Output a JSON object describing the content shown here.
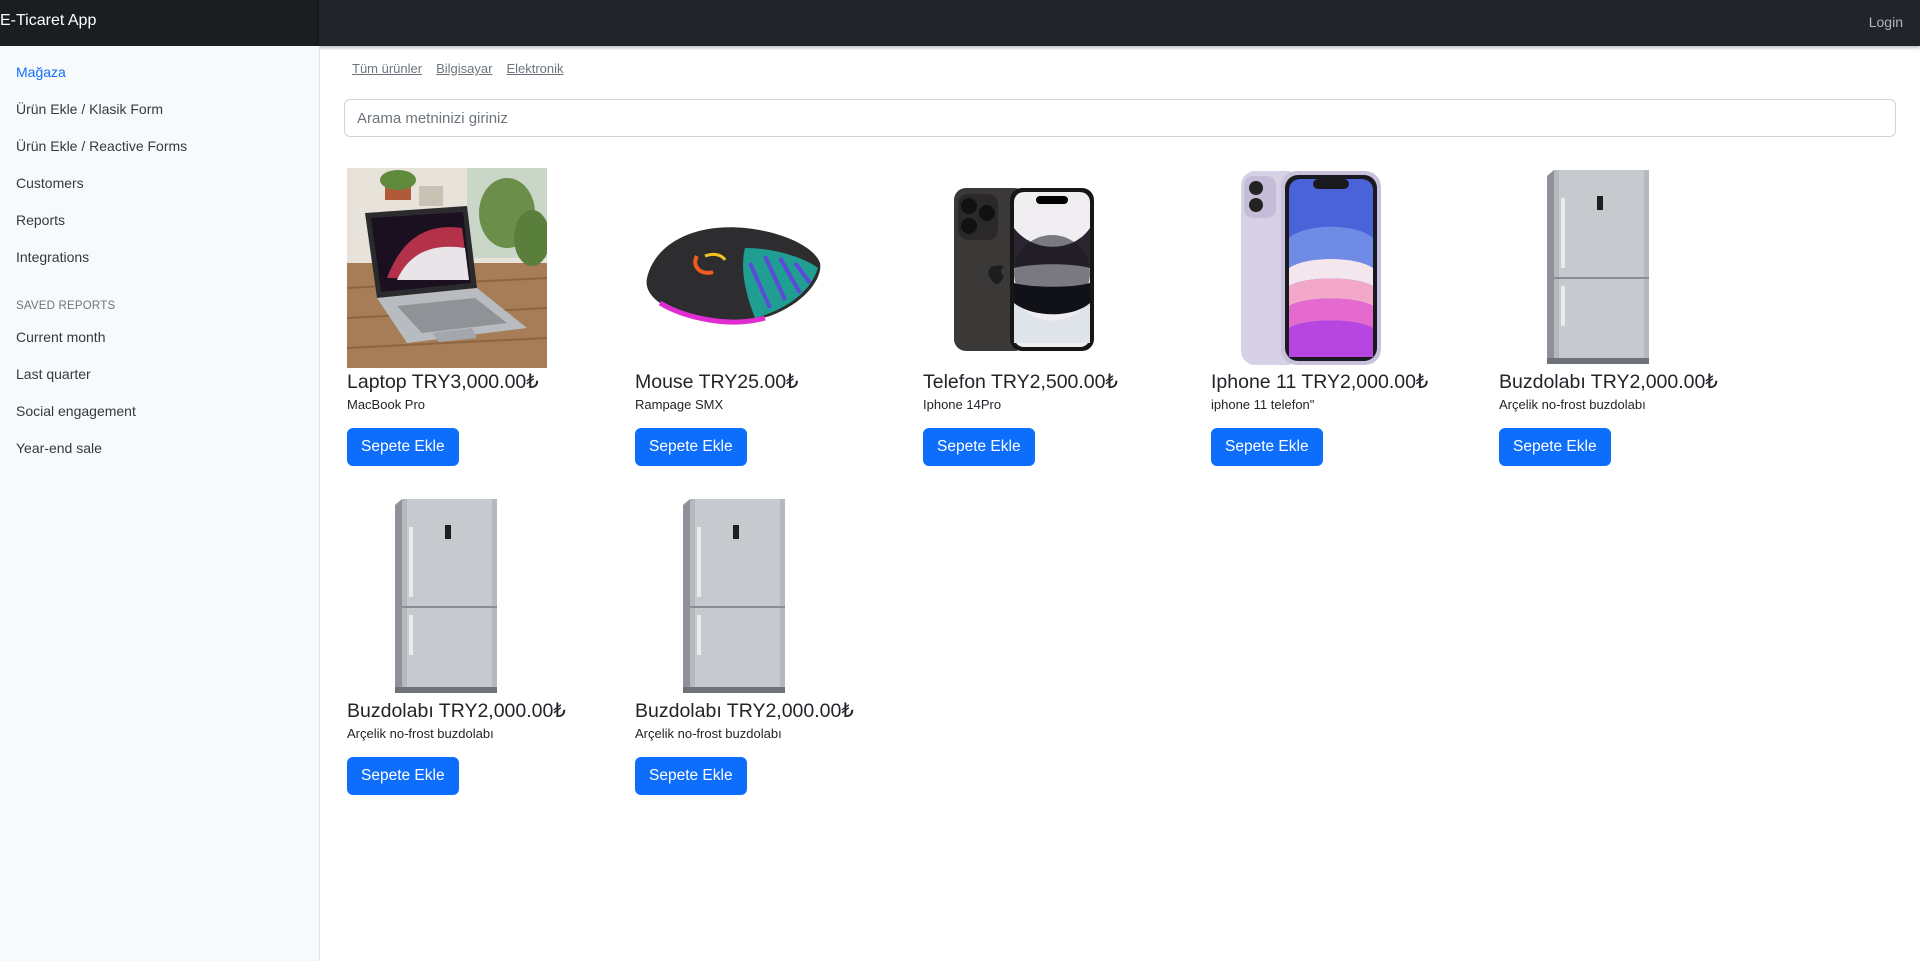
{
  "navbar": {
    "brand": "E-Ticaret App",
    "login": "Login"
  },
  "sidebar": {
    "items": [
      {
        "label": "Mağaza"
      },
      {
        "label": "Ürün Ekle / Klasik Form"
      },
      {
        "label": "Ürün Ekle / Reactive Forms"
      },
      {
        "label": "Customers"
      },
      {
        "label": "Reports"
      },
      {
        "label": "Integrations"
      }
    ],
    "saved_heading": "SAVED REPORTS",
    "saved_items": [
      {
        "label": "Current month"
      },
      {
        "label": "Last quarter"
      },
      {
        "label": "Social engagement"
      },
      {
        "label": "Year-end sale"
      }
    ]
  },
  "categories": [
    "Tüm ürünler",
    "Bilgisayar",
    "Elektronik"
  ],
  "search": {
    "placeholder": "Arama metninizi giriniz",
    "value": ""
  },
  "products": [
    {
      "title": "Laptop TRY3,000.00₺",
      "description": "MacBook Pro",
      "button": "Sepete Ekle",
      "image": "laptop"
    },
    {
      "title": "Mouse TRY25.00₺",
      "description": "Rampage SMX",
      "button": "Sepete Ekle",
      "image": "mouse"
    },
    {
      "title": "Telefon TRY2,500.00₺",
      "description": "Iphone 14Pro",
      "button": "Sepete Ekle",
      "image": "iphone14"
    },
    {
      "title": "Iphone 11 TRY2,000.00₺",
      "description": "iphone 11 telefon\"",
      "button": "Sepete Ekle",
      "image": "iphone11"
    },
    {
      "title": "Buzdolabı TRY2,000.00₺",
      "description": "Arçelik no-frost buzdolabı",
      "button": "Sepete Ekle",
      "image": "fridge"
    },
    {
      "title": "Buzdolabı TRY2,000.00₺",
      "description": "Arçelik no-frost buzdolabı",
      "button": "Sepete Ekle",
      "image": "fridge"
    },
    {
      "title": "Buzdolabı TRY2,000.00₺",
      "description": "Arçelik no-frost buzdolabı",
      "button": "Sepete Ekle",
      "image": "fridge"
    }
  ],
  "colors": {
    "navbar_bg": "#212529",
    "primary": "#0d6efd",
    "sidebar_bg": "#f8f9fa",
    "active_link": "#0d6efd"
  }
}
